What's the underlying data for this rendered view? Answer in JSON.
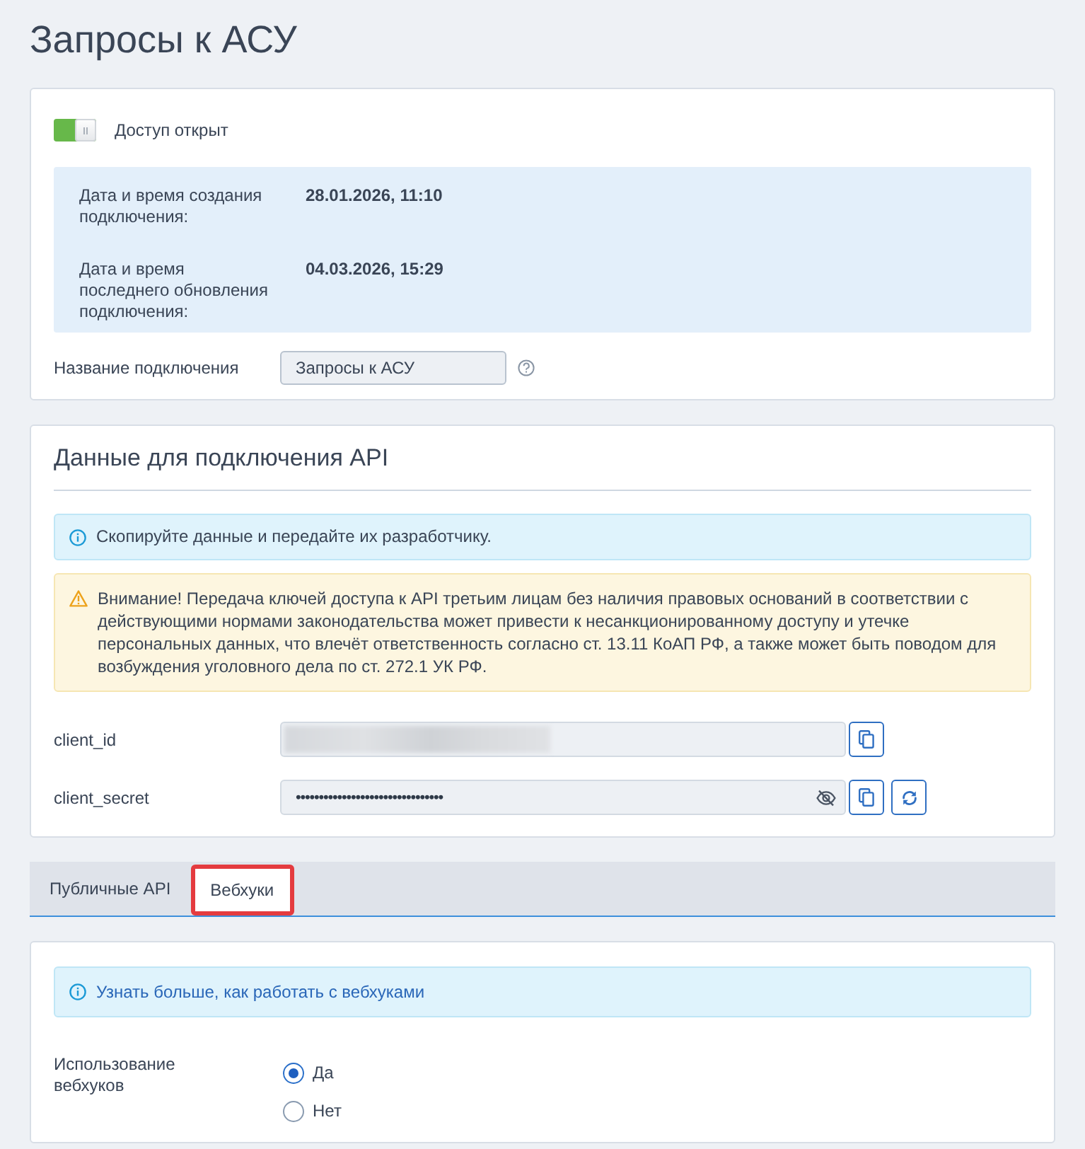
{
  "page": {
    "title": "Запросы к АСУ"
  },
  "access": {
    "on": true,
    "label": "Доступ открыт"
  },
  "details": [
    {
      "label": "Дата и время создания подключения:",
      "value": "28.01.2026, 11:10"
    },
    {
      "label": "Дата и время последнего обновления подключения:",
      "value": "04.03.2026, 15:29"
    }
  ],
  "connection_name": {
    "label": "Название подключения",
    "value": "Запросы к АСУ"
  },
  "api_credentials": {
    "title": "Данные для подключения API",
    "info": "Скопируйте данные и передайте их разработчику.",
    "warning": "Внимание! Передача ключей доступа к API третьим лицам без наличия правовых оснований в соответствии с действующими нормами законодательства может привести к несанкционированному доступу и утечке персональных данных, что влечёт ответственность согласно ст. 13.11 КоАП РФ, а также может быть поводом для возбуждения уголовного дела по ст. 272.1 УК РФ.",
    "fields": [
      {
        "label": "client_id",
        "kind": "blurred",
        "actions": [
          {
            "kind": "copy"
          }
        ]
      },
      {
        "label": "client_secret",
        "kind": "secret",
        "value": "••••••••••••••••••••••••••••••••",
        "masked": true,
        "actions": [
          {
            "kind": "copy"
          },
          {
            "kind": "refresh"
          }
        ]
      }
    ]
  },
  "tabs": [
    {
      "label": "Публичные API",
      "selected": false,
      "highlighted": false
    },
    {
      "label": "Вебхуки",
      "selected": true,
      "highlighted": true
    }
  ],
  "webhooks": {
    "info_link": "Узнать больше, как работать с вебхуками",
    "usage": {
      "label": "Использование вебхуков",
      "options": [
        {
          "label": "Да",
          "selected": true
        },
        {
          "label": "Нет",
          "selected": false
        }
      ]
    }
  }
}
